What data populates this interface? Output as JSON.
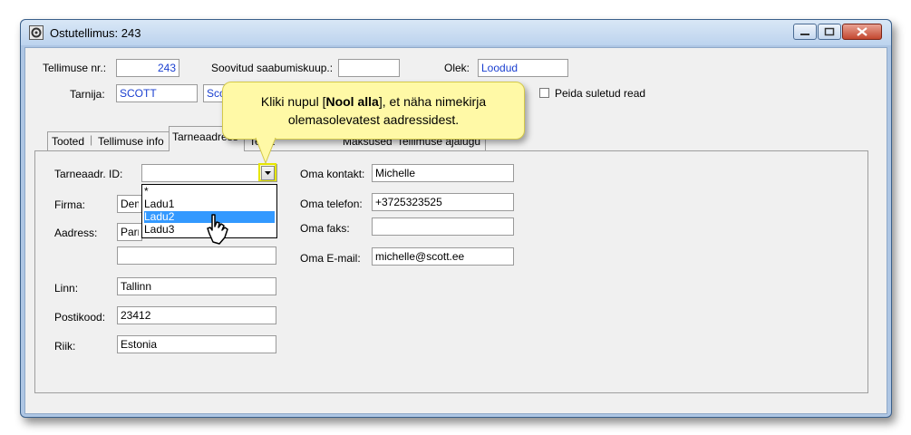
{
  "window": {
    "title": "Ostutellimus: 243"
  },
  "header": {
    "order_no_label": "Tellimuse nr.:",
    "order_no_value": "243",
    "due_label": "Soovitud saabumiskuup.:",
    "due_value": "",
    "status_label": "Olek:",
    "status_value": "Loodud",
    "supplier_label": "Tarnija:",
    "supplier_code": "SCOTT",
    "supplier_name_partial": "Sco",
    "hide_closed_label": "Peida suletud read"
  },
  "tabs": [
    {
      "label": "Tooted"
    },
    {
      "label": "Tellimuse info"
    },
    {
      "label": "Tarneaadress"
    },
    {
      "label": "Tekst"
    },
    {
      "label": "Maksused"
    },
    {
      "label": "Tellimuse ajalugu"
    }
  ],
  "form": {
    "address_id_label": "Tarneaadr. ID:",
    "address_id_value": "",
    "company_label": "Firma:",
    "company_value": "Dem",
    "address_label": "Aadress:",
    "address_value": "Parr",
    "address2_value": "",
    "city_label": "Linn:",
    "city_value": "Tallinn",
    "postal_label": "Postikood:",
    "postal_value": "23412",
    "country_label": "Riik:",
    "country_value": "Estonia",
    "contact_label": "Oma kontakt:",
    "contact_value": "Michelle",
    "phone_label": "Oma telefon:",
    "phone_value": "+3725323525",
    "fax_label": "Oma faks:",
    "fax_value": "",
    "email_label": "Oma E-mail:",
    "email_value": "michelle@scott.ee"
  },
  "dropdown": {
    "options": [
      "*",
      "Ladu1",
      "Ladu2",
      "Ladu3"
    ],
    "selected": "Ladu2"
  },
  "callout": {
    "text_before": "Kliki nupul [",
    "text_bold": "Nool alla",
    "text_after": "], et näha nimekirja",
    "text_line2": "olemasolevatest aadressidest."
  },
  "colors": {
    "titlebar": "#c9dcf2",
    "highlight": "#3399ff",
    "callout": "#fff9a6",
    "blue_text": "#1a3fd0"
  }
}
